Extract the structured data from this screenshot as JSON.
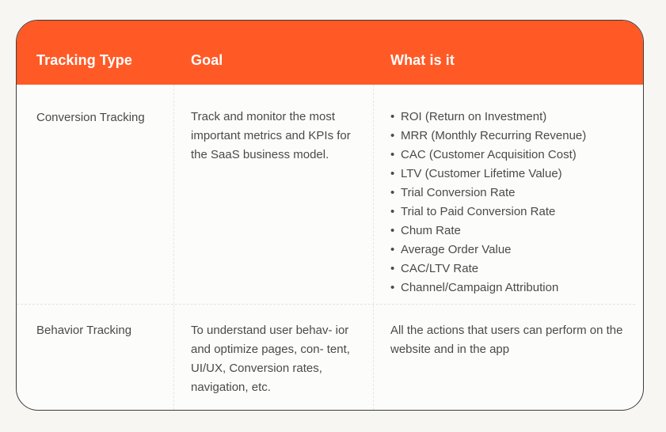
{
  "table": {
    "headers": {
      "tracking_type": "Tracking Type",
      "goal": "Goal",
      "what_is_it": "What is it"
    },
    "rows": [
      {
        "tracking_type": "Conversion Tracking",
        "goal": "Track and monitor the most important metrics and KPIs for the SaaS business model.",
        "what_is_it_items": [
          "ROI (Return on Investment)",
          "MRR (Monthly Recurring Revenue)",
          "CAC (Customer Acquisition Cost)",
          "LTV (Customer Lifetime Value)",
          "Trial Conversion Rate",
          "Trial to Paid Conversion Rate",
          "Chum Rate",
          "Average Order Value",
          "CAC/LTV Rate",
          "Channel/Campaign Attribution"
        ]
      },
      {
        "tracking_type": "Behavior Tracking",
        "goal": "To understand user behav- ior and optimize pages, con- tent, UI/UX, Conversion rates, navigation, etc.",
        "what_is_it": "All the actions that users can perform on the website and in the app"
      }
    ],
    "bullet_glyph": "•"
  },
  "colors": {
    "header_bg": "#ff5a26",
    "header_text": "#ffffff",
    "body_text": "#4a4a4a",
    "page_bg": "#f7f6f2",
    "card_bg": "#fcfcfb",
    "card_border": "#3d3d3d"
  }
}
